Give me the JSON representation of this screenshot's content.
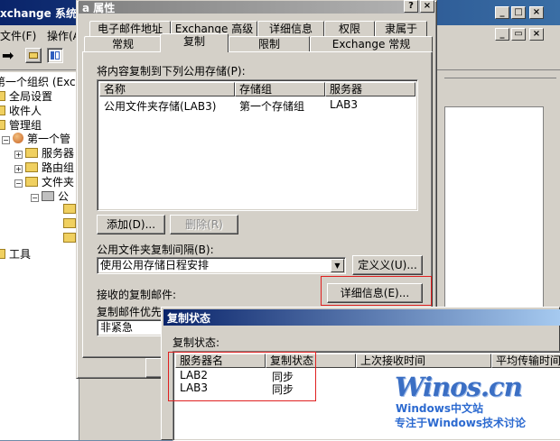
{
  "mmc": {
    "title": "xchange 系统管",
    "menu": [
      "文件(F)",
      "操作(A)"
    ],
    "tree": [
      {
        "label": "第一个组织 (Exc"
      },
      {
        "label": "全局设置"
      },
      {
        "label": "收件人"
      },
      {
        "label": "管理组"
      },
      {
        "label": "第一个管"
      },
      {
        "label": "服务器"
      },
      {
        "label": "路由组"
      },
      {
        "label": "文件夹"
      },
      {
        "label": "公"
      },
      {
        "label": "工具"
      }
    ],
    "buttons": {
      "minimize": "_",
      "maximize": "□",
      "close": "×",
      "restore": "▭"
    }
  },
  "dialog": {
    "title": "a 属性",
    "help_btn": "?",
    "close_btn": "×",
    "tabs_back": [
      "电子邮件地址",
      "Exchange 高级",
      "详细信息",
      "权限",
      "隶属于"
    ],
    "tabs_front": [
      "常规",
      "复制",
      "限制",
      "Exchange 常规"
    ],
    "active_tab": "复制",
    "stores_label": "将内容复制到下列公用存储(P):",
    "stores_columns": [
      "名称",
      "存储组",
      "服务器"
    ],
    "stores_rows": [
      {
        "name": "公用文件夹存储(LAB3)",
        "group": "第一个存储组",
        "server": "LAB3"
      }
    ],
    "add_btn": "添加(D)...",
    "remove_btn": "删除(R)",
    "interval_label": "公用文件夹复制间隔(B):",
    "interval_value": "使用公用存储日程安排",
    "custom_btn": "定义义(U)...",
    "received_label": "接收的复制邮件:",
    "details_btn": "详细信息(E)...",
    "priority_label": "复制邮件优先",
    "priority_value": "非紧急"
  },
  "status_dialog": {
    "title": "复制状态",
    "label": "复制状态:",
    "columns": [
      "服务器名",
      "复制状态",
      "上次接收时间",
      "平均传输时间"
    ],
    "rows": [
      {
        "server": "LAB2",
        "state": "同步"
      },
      {
        "server": "LAB3",
        "state": "同步"
      }
    ]
  },
  "watermark": {
    "big": "Winos.cn",
    "line1": "Windows中文站",
    "line2": "专注于Windows技术讨论"
  }
}
